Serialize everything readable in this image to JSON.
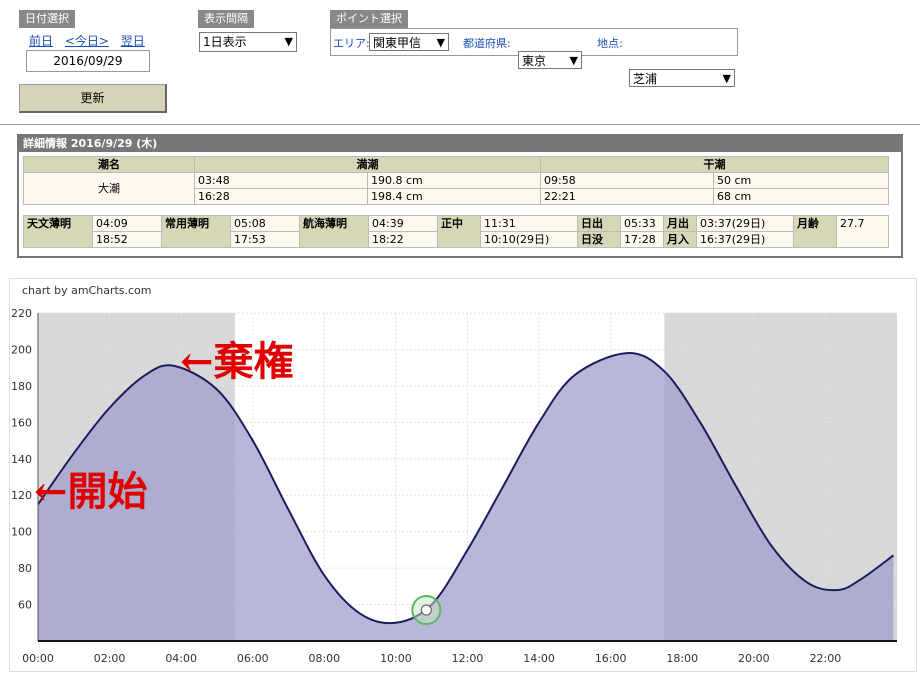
{
  "date_select": {
    "header": "日付選択",
    "prev": "前日",
    "today": "<今日>",
    "next": "翌日",
    "date": "2016/09/29"
  },
  "interval_select": {
    "header": "表示間隔",
    "value": "1日表示"
  },
  "point_select": {
    "header": "ポイント選択",
    "area_label": "エリア:",
    "area_value": "関東甲信",
    "pref_label": "都道府県:",
    "pref_value": "東京",
    "point_label": "地点:",
    "point_value": "芝浦"
  },
  "update_button": "更新",
  "detail": {
    "title": "詳細情報  2016/9/29 (木)",
    "col_name": "潮名",
    "col_high": "満潮",
    "col_low": "干潮",
    "tide_name": "大潮",
    "high": [
      [
        "03:48",
        "190.8 cm"
      ],
      [
        "16:28",
        "198.4 cm"
      ]
    ],
    "low": [
      [
        "09:58",
        "50 cm"
      ],
      [
        "22:21",
        "68 cm"
      ]
    ],
    "astro_label": "天文薄明",
    "astro": [
      "04:09",
      "18:52"
    ],
    "civil_label": "常用薄明",
    "civil": [
      "05:08",
      "17:53"
    ],
    "naut_label": "航海薄明",
    "naut": [
      "04:39",
      "18:22"
    ],
    "noon_label": "正中",
    "noon": [
      "11:31",
      "10:10(29日)"
    ],
    "sunrise_label": "日出",
    "sunrise": "05:33",
    "sunset_label": "日没",
    "sunset": "17:28",
    "moonrise_label": "月出",
    "moonrise": "03:37(29日)",
    "moonset_label": "月入",
    "moonset": "16:37(29日)",
    "moonage_label": "月齢",
    "moonage": "27.7"
  },
  "chart_credit": "chart by amCharts.com",
  "annotations": {
    "start": "←開始",
    "abandon": "←棄権",
    "start_color": "#e00000"
  },
  "chart_data": {
    "type": "area",
    "x_unit": "hours",
    "ylim": [
      40,
      220
    ],
    "yticks": [
      60,
      80,
      100,
      120,
      140,
      160,
      180,
      200,
      220
    ],
    "xticks": [
      "00:00",
      "02:00",
      "04:00",
      "06:00",
      "08:00",
      "10:00",
      "12:00",
      "14:00",
      "16:00",
      "18:00",
      "20:00",
      "22:00"
    ],
    "points": [
      [
        0,
        115
      ],
      [
        1,
        143
      ],
      [
        2,
        168
      ],
      [
        3,
        186
      ],
      [
        3.8,
        191
      ],
      [
        5,
        178
      ],
      [
        6,
        150
      ],
      [
        7,
        112
      ],
      [
        8,
        76
      ],
      [
        9,
        55
      ],
      [
        10,
        50
      ],
      [
        11,
        60
      ],
      [
        12,
        90
      ],
      [
        13,
        125
      ],
      [
        14,
        160
      ],
      [
        15,
        186
      ],
      [
        16.47,
        198
      ],
      [
        17.5,
        188
      ],
      [
        18.5,
        160
      ],
      [
        19.5,
        125
      ],
      [
        20.5,
        92
      ],
      [
        21.5,
        72
      ],
      [
        22.35,
        68
      ],
      [
        23,
        74
      ],
      [
        23.9,
        87
      ]
    ],
    "night_shading": [
      [
        0,
        5.5
      ],
      [
        17.5,
        24
      ]
    ],
    "cursor": {
      "x": 10.85,
      "y": 57
    },
    "fill_color": "#9fa0cc",
    "line_color": "#1c1c5e",
    "grid": true
  }
}
